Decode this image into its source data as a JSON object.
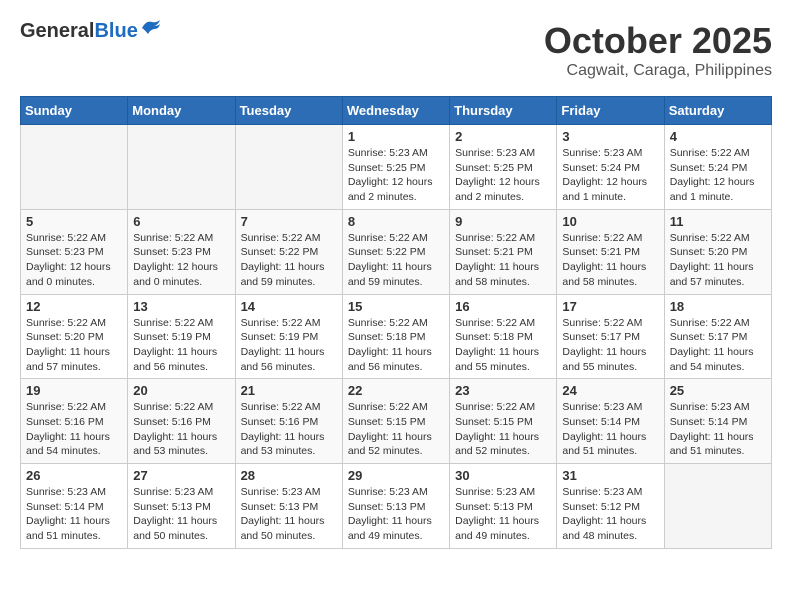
{
  "header": {
    "logo_general": "General",
    "logo_blue": "Blue",
    "month": "October 2025",
    "location": "Cagwait, Caraga, Philippines"
  },
  "days_of_week": [
    "Sunday",
    "Monday",
    "Tuesday",
    "Wednesday",
    "Thursday",
    "Friday",
    "Saturday"
  ],
  "weeks": [
    [
      {
        "day": "",
        "info": ""
      },
      {
        "day": "",
        "info": ""
      },
      {
        "day": "",
        "info": ""
      },
      {
        "day": "1",
        "info": "Sunrise: 5:23 AM\nSunset: 5:25 PM\nDaylight: 12 hours\nand 2 minutes."
      },
      {
        "day": "2",
        "info": "Sunrise: 5:23 AM\nSunset: 5:25 PM\nDaylight: 12 hours\nand 2 minutes."
      },
      {
        "day": "3",
        "info": "Sunrise: 5:23 AM\nSunset: 5:24 PM\nDaylight: 12 hours\nand 1 minute."
      },
      {
        "day": "4",
        "info": "Sunrise: 5:22 AM\nSunset: 5:24 PM\nDaylight: 12 hours\nand 1 minute."
      }
    ],
    [
      {
        "day": "5",
        "info": "Sunrise: 5:22 AM\nSunset: 5:23 PM\nDaylight: 12 hours\nand 0 minutes."
      },
      {
        "day": "6",
        "info": "Sunrise: 5:22 AM\nSunset: 5:23 PM\nDaylight: 12 hours\nand 0 minutes."
      },
      {
        "day": "7",
        "info": "Sunrise: 5:22 AM\nSunset: 5:22 PM\nDaylight: 11 hours\nand 59 minutes."
      },
      {
        "day": "8",
        "info": "Sunrise: 5:22 AM\nSunset: 5:22 PM\nDaylight: 11 hours\nand 59 minutes."
      },
      {
        "day": "9",
        "info": "Sunrise: 5:22 AM\nSunset: 5:21 PM\nDaylight: 11 hours\nand 58 minutes."
      },
      {
        "day": "10",
        "info": "Sunrise: 5:22 AM\nSunset: 5:21 PM\nDaylight: 11 hours\nand 58 minutes."
      },
      {
        "day": "11",
        "info": "Sunrise: 5:22 AM\nSunset: 5:20 PM\nDaylight: 11 hours\nand 57 minutes."
      }
    ],
    [
      {
        "day": "12",
        "info": "Sunrise: 5:22 AM\nSunset: 5:20 PM\nDaylight: 11 hours\nand 57 minutes."
      },
      {
        "day": "13",
        "info": "Sunrise: 5:22 AM\nSunset: 5:19 PM\nDaylight: 11 hours\nand 56 minutes."
      },
      {
        "day": "14",
        "info": "Sunrise: 5:22 AM\nSunset: 5:19 PM\nDaylight: 11 hours\nand 56 minutes."
      },
      {
        "day": "15",
        "info": "Sunrise: 5:22 AM\nSunset: 5:18 PM\nDaylight: 11 hours\nand 56 minutes."
      },
      {
        "day": "16",
        "info": "Sunrise: 5:22 AM\nSunset: 5:18 PM\nDaylight: 11 hours\nand 55 minutes."
      },
      {
        "day": "17",
        "info": "Sunrise: 5:22 AM\nSunset: 5:17 PM\nDaylight: 11 hours\nand 55 minutes."
      },
      {
        "day": "18",
        "info": "Sunrise: 5:22 AM\nSunset: 5:17 PM\nDaylight: 11 hours\nand 54 minutes."
      }
    ],
    [
      {
        "day": "19",
        "info": "Sunrise: 5:22 AM\nSunset: 5:16 PM\nDaylight: 11 hours\nand 54 minutes."
      },
      {
        "day": "20",
        "info": "Sunrise: 5:22 AM\nSunset: 5:16 PM\nDaylight: 11 hours\nand 53 minutes."
      },
      {
        "day": "21",
        "info": "Sunrise: 5:22 AM\nSunset: 5:16 PM\nDaylight: 11 hours\nand 53 minutes."
      },
      {
        "day": "22",
        "info": "Sunrise: 5:22 AM\nSunset: 5:15 PM\nDaylight: 11 hours\nand 52 minutes."
      },
      {
        "day": "23",
        "info": "Sunrise: 5:22 AM\nSunset: 5:15 PM\nDaylight: 11 hours\nand 52 minutes."
      },
      {
        "day": "24",
        "info": "Sunrise: 5:23 AM\nSunset: 5:14 PM\nDaylight: 11 hours\nand 51 minutes."
      },
      {
        "day": "25",
        "info": "Sunrise: 5:23 AM\nSunset: 5:14 PM\nDaylight: 11 hours\nand 51 minutes."
      }
    ],
    [
      {
        "day": "26",
        "info": "Sunrise: 5:23 AM\nSunset: 5:14 PM\nDaylight: 11 hours\nand 51 minutes."
      },
      {
        "day": "27",
        "info": "Sunrise: 5:23 AM\nSunset: 5:13 PM\nDaylight: 11 hours\nand 50 minutes."
      },
      {
        "day": "28",
        "info": "Sunrise: 5:23 AM\nSunset: 5:13 PM\nDaylight: 11 hours\nand 50 minutes."
      },
      {
        "day": "29",
        "info": "Sunrise: 5:23 AM\nSunset: 5:13 PM\nDaylight: 11 hours\nand 49 minutes."
      },
      {
        "day": "30",
        "info": "Sunrise: 5:23 AM\nSunset: 5:13 PM\nDaylight: 11 hours\nand 49 minutes."
      },
      {
        "day": "31",
        "info": "Sunrise: 5:23 AM\nSunset: 5:12 PM\nDaylight: 11 hours\nand 48 minutes."
      },
      {
        "day": "",
        "info": ""
      }
    ]
  ]
}
